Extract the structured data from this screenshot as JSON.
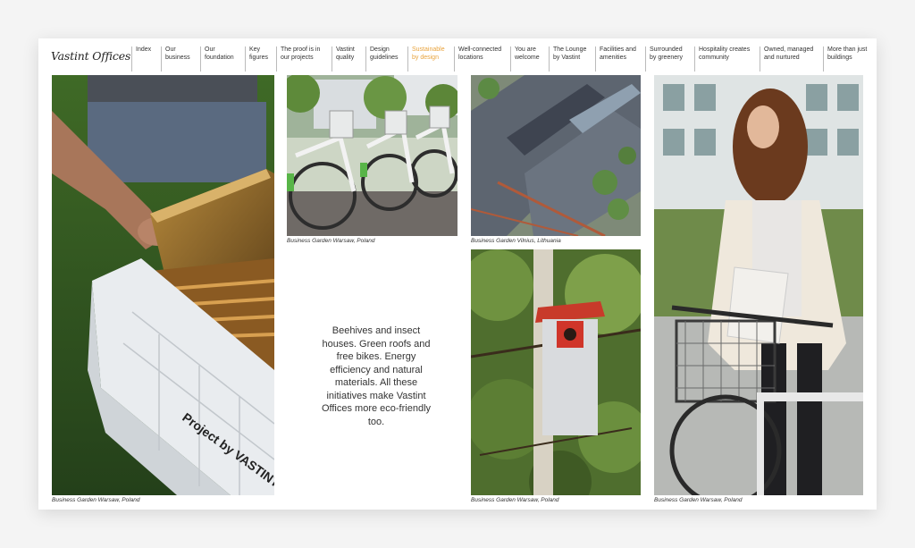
{
  "brand": {
    "logo_text": "Vastint Offices"
  },
  "nav": {
    "items": [
      {
        "label": "Index"
      },
      {
        "label": "Our business"
      },
      {
        "label": "Our foundation"
      },
      {
        "label": "Key figures"
      },
      {
        "label": "The proof is in our projects"
      },
      {
        "label": "Vastint quality"
      },
      {
        "label": "Design guidelines"
      },
      {
        "label": "Sustainable by design",
        "active": true
      },
      {
        "label": "Well-connected locations"
      },
      {
        "label": "You are welcome"
      },
      {
        "label": "The Lounge by Vastint"
      },
      {
        "label": "Facilities and amenities"
      },
      {
        "label": "Surrounded by greenery"
      },
      {
        "label": "Hospitality creates community"
      },
      {
        "label": "Owned, managed and nurtured"
      },
      {
        "label": "More than just buildings"
      }
    ],
    "active_color": "#e8a33d"
  },
  "photos": {
    "beehive": {
      "caption": "Business Garden Warsaw, Poland",
      "stamp": "Project by VASTINT"
    },
    "bikes": {
      "caption": "Business Garden Warsaw, Poland"
    },
    "roof": {
      "caption": "Business Garden Vilnius, Lithuania"
    },
    "birdhouse": {
      "caption": "Business Garden Warsaw, Poland"
    },
    "woman_bike": {
      "caption": "Business Garden Warsaw, Poland"
    }
  },
  "main": {
    "text": "Beehives and insect houses. Green roofs and free bikes. Energy efficiency and natural materials. All these initiatives make Vastint Offices more eco-friendly too."
  }
}
